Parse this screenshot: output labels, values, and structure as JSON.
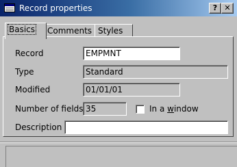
{
  "window": {
    "title": "Record properties",
    "help_label": "?",
    "close_label": "✕",
    "title_gradient": [
      "#0a246a",
      "#a6caf0"
    ]
  },
  "tabs": [
    {
      "label": "Basics",
      "active": true
    },
    {
      "label": "Comments",
      "active": false
    },
    {
      "label": "Styles",
      "active": false
    }
  ],
  "form": {
    "record_label": "Record",
    "record_value": "EMPMNT",
    "type_label": "Type",
    "type_value": "Standard",
    "modified_label": "Modified",
    "modified_value": "01/01/01",
    "fields_label": "Number of fields",
    "fields_value": "35",
    "window_label_pre": "In a ",
    "window_label_key": "w",
    "window_label_post": "indow",
    "window_checked": false,
    "description_label": "Description",
    "description_value": ""
  },
  "icons": {
    "app": "record-icon",
    "help": "help-icon",
    "close": "close-icon"
  }
}
